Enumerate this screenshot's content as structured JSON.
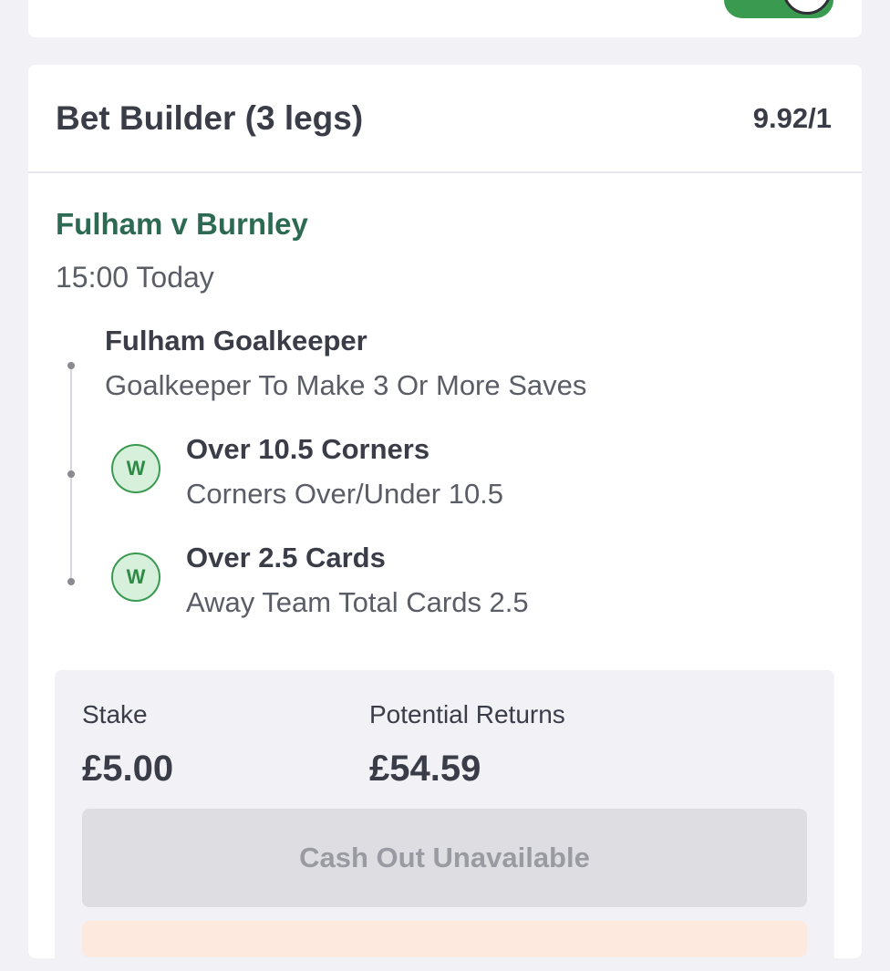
{
  "bet": {
    "title": "Bet Builder (3 legs)",
    "odds": "9.92/1",
    "match": "Fulham v Burnley",
    "time": "15:00 Today",
    "legs": [
      {
        "title": "Fulham Goalkeeper",
        "subtitle": "Goalkeeper To Make 3 Or More Saves",
        "status": ""
      },
      {
        "title": "Over 10.5 Corners",
        "subtitle": "Corners Over/Under 10.5",
        "status": "W"
      },
      {
        "title": "Over 2.5 Cards",
        "subtitle": "Away Team Total Cards 2.5",
        "status": "W"
      }
    ]
  },
  "summary": {
    "stake_label": "Stake",
    "stake_value": "£5.00",
    "returns_label": "Potential Returns",
    "returns_value": "£54.59",
    "cashout_label": "Cash Out Unavailable"
  },
  "colors": {
    "accent_green": "#3a9a4f",
    "match_green": "#2d6a54",
    "win_badge_bg": "#d6f0dc"
  }
}
